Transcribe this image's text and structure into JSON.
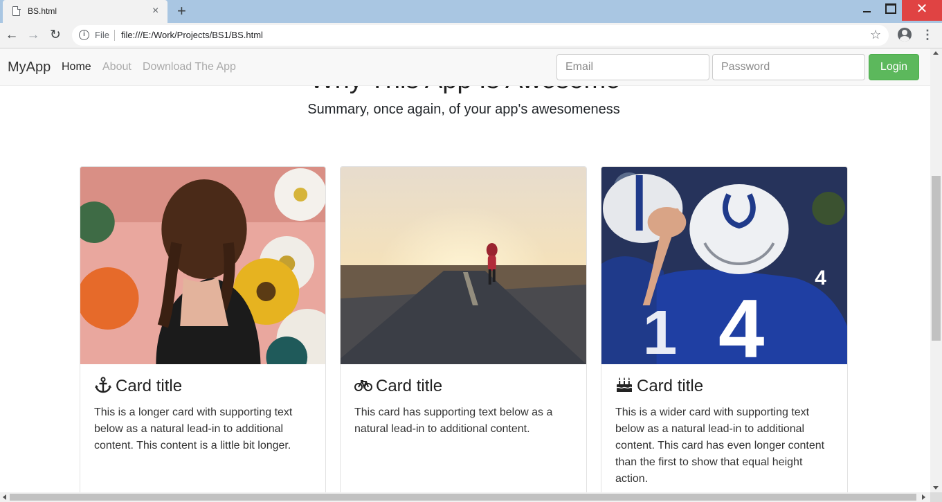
{
  "browser": {
    "tab_title": "BS.html",
    "tab_close_glyph": "×",
    "new_tab_glyph": "+",
    "close_window_glyph": "✕",
    "scheme_label": "File",
    "url": "file:///E:/Work/Projects/BS1/BS.html"
  },
  "navbar": {
    "brand": "MyApp",
    "links": [
      {
        "label": "Home",
        "active": true
      },
      {
        "label": "About",
        "active": false
      },
      {
        "label": "Download The App",
        "active": false
      }
    ],
    "email_placeholder": "Email",
    "password_placeholder": "Password",
    "login_label": "Login",
    "login_color": "#5cb85c"
  },
  "section": {
    "heading": "Why This App Is Awesome",
    "lead": "Summary, once again, of your app's awesomeness"
  },
  "cards": [
    {
      "icon": "anchor-icon",
      "title": "Card title",
      "text": "This is a longer card with supporting text below as a natural lead-in to additional content. This content is a little bit longer."
    },
    {
      "icon": "bicycle-icon",
      "title": "Card title",
      "text": "This card has supporting text below as a natural lead-in to additional content."
    },
    {
      "icon": "birthday-cake-icon",
      "title": "Card title",
      "text": "This is a wider card with supporting text below as a natural lead-in to additional content. This card has even longer content than the first to show that equal height action."
    }
  ]
}
